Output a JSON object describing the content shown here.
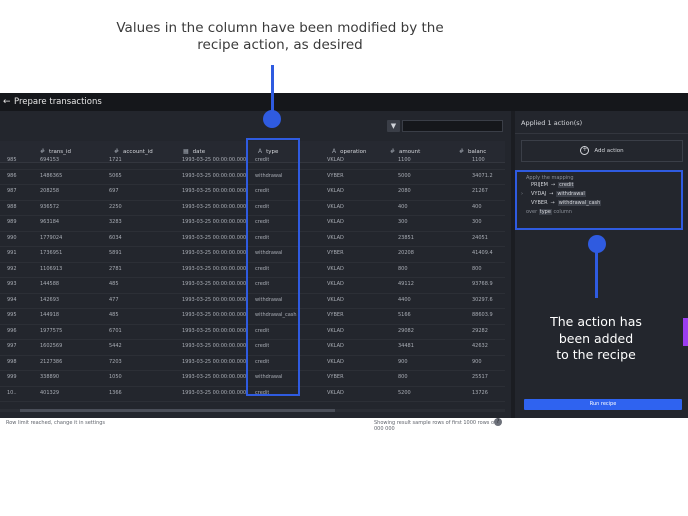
{
  "annotations": {
    "top_caption_line1": "Values in the column have been modified by the",
    "top_caption_line2": "recipe action, as desired",
    "right_caption_line1": "The action has",
    "right_caption_line2": "been added",
    "right_caption_line3": "to the recipe",
    "highlight_color": "#2f5be0"
  },
  "app": {
    "back_icon": "arrow-left-icon",
    "title": "Prepare transactions",
    "filter_icon": "funnel-icon",
    "filter_input_value": ""
  },
  "table": {
    "columns": [
      {
        "icon": "#",
        "label": "trans_id"
      },
      {
        "icon": "#",
        "label": "account_id"
      },
      {
        "icon": "▦",
        "label": "date"
      },
      {
        "icon": "A",
        "label": "type"
      },
      {
        "icon": "A",
        "label": "operation"
      },
      {
        "icon": "#",
        "label": "amount"
      },
      {
        "icon": "#",
        "label": "balanc"
      }
    ],
    "rows": [
      [
        "985",
        "694153",
        "1721",
        "1993-03-25 00:00:00.000",
        "credit",
        "VKLAD",
        "1100",
        "1100"
      ],
      [
        "986",
        "1486365",
        "5065",
        "1993-03-25 00:00:00.000",
        "withdrawal",
        "VYBER",
        "5000",
        "34071.2"
      ],
      [
        "987",
        "208258",
        "697",
        "1993-03-25 00:00:00.000",
        "credit",
        "VKLAD",
        "2080",
        "21267"
      ],
      [
        "988",
        "936572",
        "2250",
        "1993-03-25 00:00:00.000",
        "credit",
        "VKLAD",
        "400",
        "400"
      ],
      [
        "989",
        "963184",
        "3283",
        "1993-03-25 00:00:00.000",
        "credit",
        "VKLAD",
        "300",
        "300"
      ],
      [
        "990",
        "1779024",
        "6034",
        "1993-03-25 00:00:00.000",
        "credit",
        "VKLAD",
        "23851",
        "24051"
      ],
      [
        "991",
        "1736951",
        "5891",
        "1993-03-25 00:00:00.000",
        "withdrawal",
        "VYBER",
        "20208",
        "41409.4"
      ],
      [
        "992",
        "1106913",
        "2781",
        "1993-03-25 00:00:00.000",
        "credit",
        "VKLAD",
        "800",
        "800"
      ],
      [
        "993",
        "144588",
        "485",
        "1993-03-25 00:00:00.000",
        "credit",
        "VKLAD",
        "49112",
        "93768.9"
      ],
      [
        "994",
        "142693",
        "477",
        "1993-03-25 00:00:00.000",
        "withdrawal",
        "VKLAD",
        "4400",
        "30297.6"
      ],
      [
        "995",
        "144918",
        "485",
        "1993-03-25 00:00:00.000",
        "withdrawal_cash",
        "VYBER",
        "5166",
        "88603.9"
      ],
      [
        "996",
        "1977575",
        "6701",
        "1993-03-25 00:00:00.000",
        "credit",
        "VKLAD",
        "29082",
        "29282"
      ],
      [
        "997",
        "1602569",
        "5442",
        "1993-03-25 00:00:00.000",
        "credit",
        "VKLAD",
        "34481",
        "42632"
      ],
      [
        "998",
        "2127386",
        "7203",
        "1993-03-25 00:00:00.000",
        "credit",
        "VKLAD",
        "900",
        "900"
      ],
      [
        "999",
        "338890",
        "1050",
        "1993-03-25 00:00:00.000",
        "withdrawal",
        "VYBER",
        "800",
        "25517"
      ],
      [
        "10..",
        "401329",
        "1366",
        "1993-03-25 00:00:00.000",
        "credit",
        "VKLAD",
        "5200",
        "13726"
      ]
    ],
    "footer_left": "Row limit reached, change it in settings",
    "footer_right": "Showing result sample rows of first 1000 rows of 1 000 000",
    "help_icon": "?"
  },
  "recipe": {
    "title": "Applied 1 action(s)",
    "add_action_icon": "plus-circle-icon",
    "add_action_label": "Add action",
    "action_heading": "Apply the mapping",
    "mappings": [
      {
        "from": "PRIJEM",
        "arrow": "→",
        "to": "credit"
      },
      {
        "from": "VYDAJ",
        "arrow": "→",
        "to": "withdrawal"
      },
      {
        "from": "VYBER",
        "arrow": "→",
        "to": "withdrawal_cash"
      }
    ],
    "expand_icon": "›",
    "column_prefix": "over",
    "column_name": "type",
    "column_suffix": "column",
    "run_label": "Run recipe"
  }
}
